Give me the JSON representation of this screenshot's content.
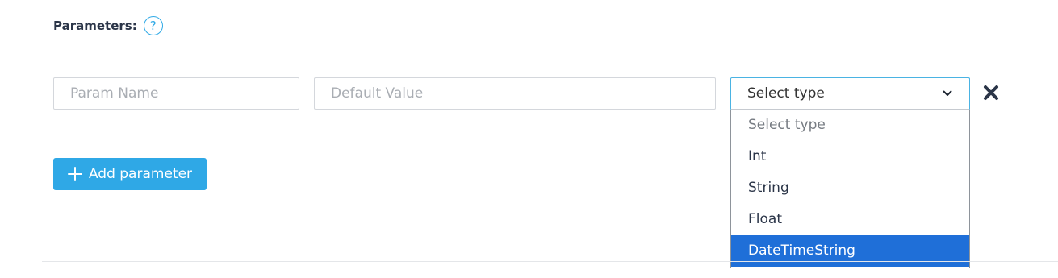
{
  "parameters": {
    "title": "Parameters:",
    "help_icon": "question-circle-icon",
    "row": {
      "name_placeholder": "Param Name",
      "default_placeholder": "Default Value",
      "type_selected": "Select type",
      "remove_icon": "close-x-icon"
    },
    "type_options": [
      "Select type",
      "Int",
      "String",
      "Float",
      "DateTimeString"
    ],
    "highlighted_option": "DateTimeString",
    "add_button_label": "Add parameter",
    "add_icon": "plus-icon"
  },
  "colors": {
    "accent": "#2fa8e6",
    "option_highlight": "#1f6fd8",
    "text": "#2b3548"
  }
}
